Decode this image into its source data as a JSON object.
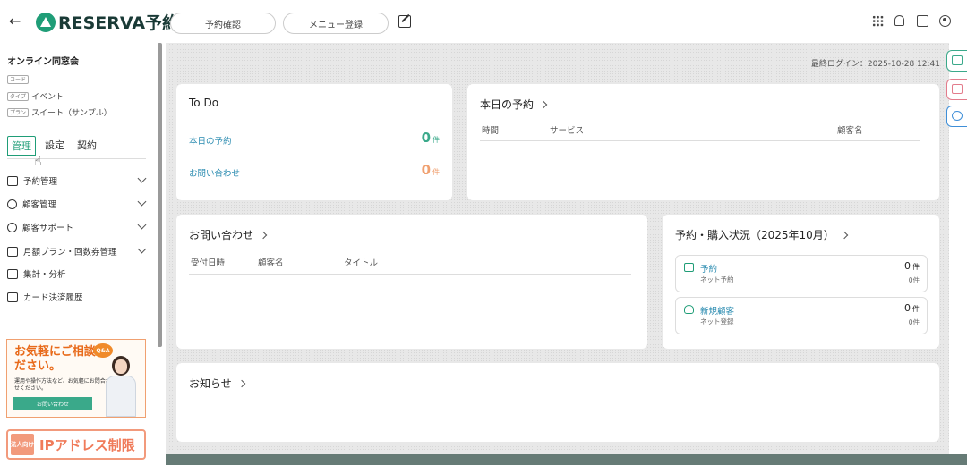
{
  "topbar": {
    "logo": "RESERVA予約",
    "pill_reservation": "予約確認",
    "pill_menu": "メニュー登録"
  },
  "sidebar": {
    "org_name": "オンライン同窓会",
    "code_tag": "コード",
    "type_tag": "タイプ",
    "type_value": "イベント",
    "plan_tag": "プラン",
    "plan_value": "スイート（サンプル）",
    "tabs": [
      "管理",
      "設定",
      "契約"
    ],
    "menu": [
      {
        "label": "予約管理",
        "icon": "calendar-icon"
      },
      {
        "label": "顧客管理",
        "icon": "users-icon"
      },
      {
        "label": "顧客サポート",
        "icon": "user-plus-icon"
      },
      {
        "label": "月額プラン・回数券管理",
        "icon": "refresh-icon"
      },
      {
        "label": "集計・分析",
        "icon": "chart-icon"
      },
      {
        "label": "カード決済履歴",
        "icon": "card-icon"
      }
    ],
    "banner_support": {
      "title": "お気軽にご相談ください。",
      "badge": "Q&A",
      "sub": "運用や操作方法など、お気軽にお問合わせください。",
      "button": "お問い合わせ"
    },
    "banner_ip": {
      "badge": "法人向け",
      "text": "IPアドレス制限"
    }
  },
  "main": {
    "last_login": "最終ログイン：2025-10-28 12:41",
    "todo": {
      "title": "To Do",
      "rows": [
        {
          "label": "本日の予約",
          "value": "0",
          "unit": "件",
          "color": "#3aa98a"
        },
        {
          "label": "お問い合わせ",
          "value": "0",
          "unit": "件",
          "color": "#f0a070"
        }
      ]
    },
    "today": {
      "title": "本日の予約",
      "columns": [
        "時間",
        "サービス",
        "顧客名"
      ]
    },
    "inquiries": {
      "title": "お問い合わせ",
      "columns": [
        "受付日時",
        "顧客名",
        "タイトル"
      ]
    },
    "status": {
      "title": "予約・購入状況（2025年10月）",
      "items": [
        {
          "label": "予約",
          "sub": "ネット予約",
          "value": "0",
          "unit": "件",
          "sub_value": "0件"
        },
        {
          "label": "新規顧客",
          "sub": "ネット登録",
          "value": "0",
          "unit": "件",
          "sub_value": "0件"
        }
      ]
    },
    "news": {
      "title": "お知らせ"
    }
  }
}
